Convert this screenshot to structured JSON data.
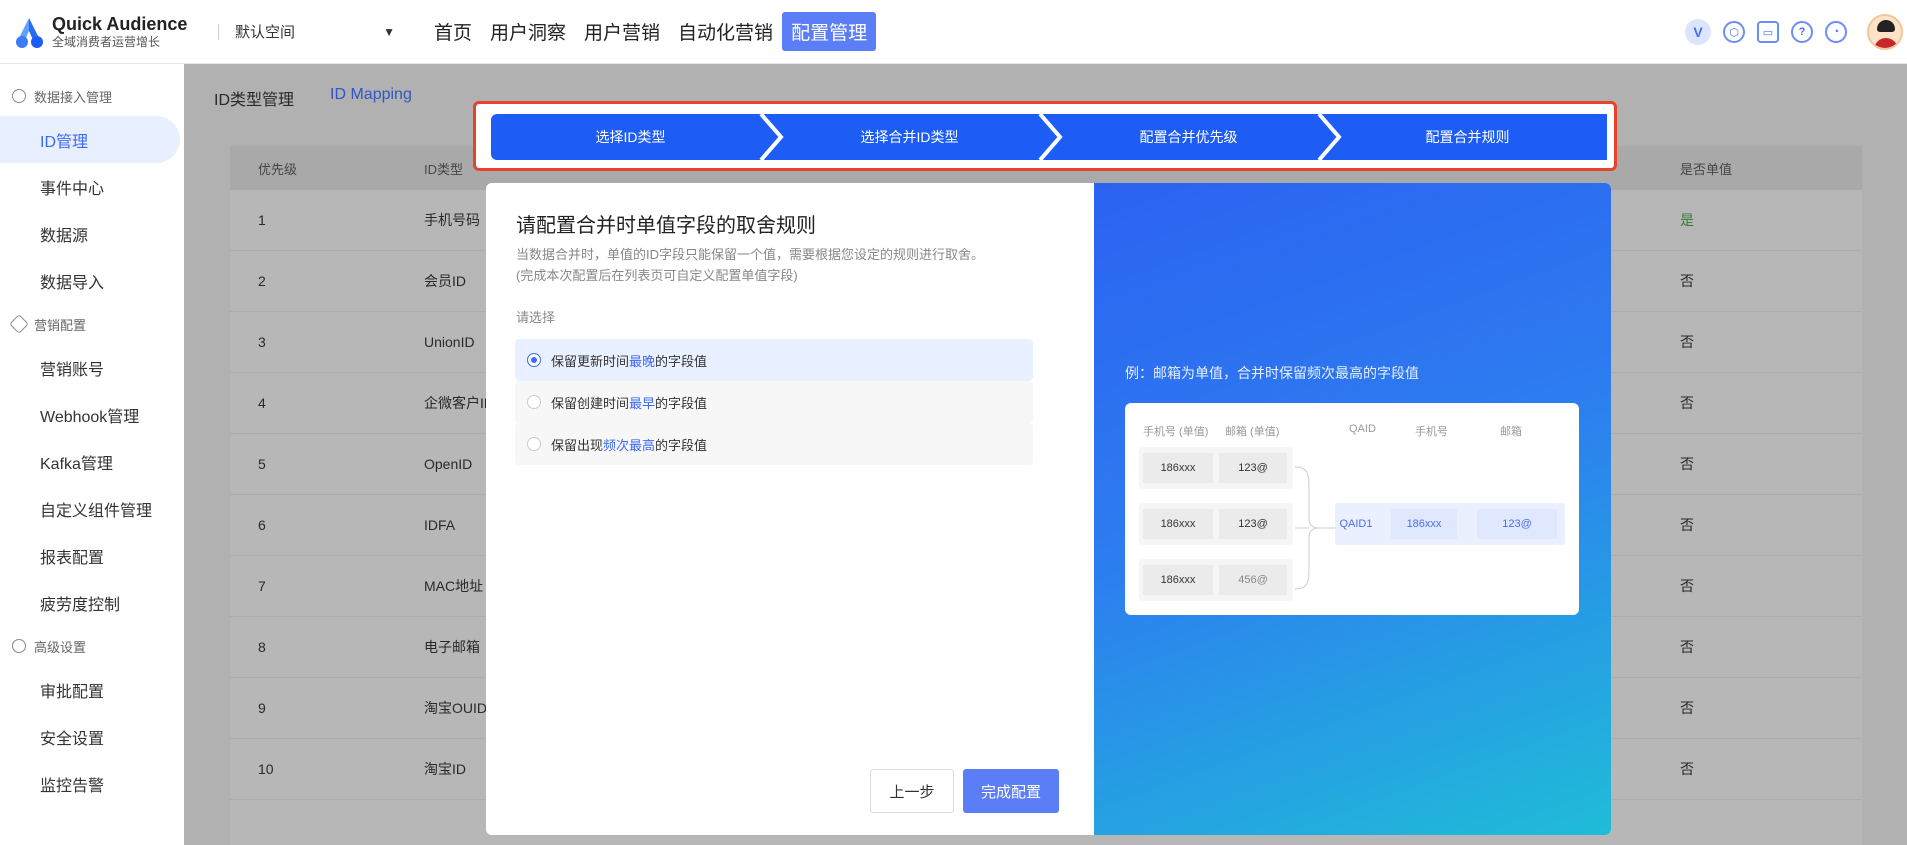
{
  "app": {
    "title": "Quick Audience",
    "subtitle": "全域消费者运营增长"
  },
  "workspace": {
    "name": "默认空间"
  },
  "nav": [
    {
      "label": "首页",
      "active": false
    },
    {
      "label": "用户洞察",
      "active": false
    },
    {
      "label": "用户营销",
      "active": false
    },
    {
      "label": "自动化营销",
      "active": false
    },
    {
      "label": "配置管理",
      "active": true
    }
  ],
  "top_icons": {
    "v_label": "V"
  },
  "sidebar": {
    "groups": [
      {
        "label": "数据接入管理",
        "items": [
          {
            "label": "ID管理",
            "active": true
          },
          {
            "label": "事件中心"
          },
          {
            "label": "数据源"
          },
          {
            "label": "数据导入"
          }
        ]
      },
      {
        "label": "营销配置",
        "items": [
          {
            "label": "营销账号"
          },
          {
            "label": "Webhook管理"
          },
          {
            "label": "Kafka管理"
          },
          {
            "label": "自定义组件管理"
          },
          {
            "label": "报表配置"
          },
          {
            "label": "疲劳度控制"
          }
        ]
      },
      {
        "label": "高级设置",
        "items": [
          {
            "label": "审批配置"
          },
          {
            "label": "安全设置"
          },
          {
            "label": "监控告警"
          }
        ]
      }
    ]
  },
  "subtabs": [
    {
      "label": "ID类型管理",
      "active": false
    },
    {
      "label": "ID Mapping",
      "active": true
    }
  ],
  "table": {
    "headers": {
      "priority": "优先级",
      "id_type": "ID类型",
      "single": "是否单值"
    },
    "rows": [
      {
        "priority": "1",
        "id_type": "手机号码",
        "single": "是"
      },
      {
        "priority": "2",
        "id_type": "会员ID",
        "single": "否"
      },
      {
        "priority": "3",
        "id_type": "UnionID",
        "single": "否"
      },
      {
        "priority": "4",
        "id_type": "企微客户ID",
        "single": "否"
      },
      {
        "priority": "5",
        "id_type": "OpenID",
        "single": "否"
      },
      {
        "priority": "6",
        "id_type": "IDFA",
        "single": "否"
      },
      {
        "priority": "7",
        "id_type": "MAC地址",
        "single": "否"
      },
      {
        "priority": "8",
        "id_type": "电子邮箱",
        "single": "否"
      },
      {
        "priority": "9",
        "id_type": "淘宝OUID",
        "single": "否"
      },
      {
        "priority": "10",
        "id_type": "淘宝ID",
        "single": "否"
      }
    ]
  },
  "steps": [
    "选择ID类型",
    "选择合并ID类型",
    "配置合并优先级",
    "配置合并规则"
  ],
  "dialog": {
    "title": "请配置合并时单值字段的取舍规则",
    "desc_line1": "当数据合并时，单值的ID字段只能保留一个值，需要根据您设定的规则进行取舍。",
    "desc_line2": "(完成本次配置后在列表页可自定义配置单值字段)",
    "choose_label": "请选择",
    "options": [
      {
        "pre": "保留更新时间",
        "hl": "最晚",
        "post": "的字段值",
        "selected": true
      },
      {
        "pre": "保留创建时间",
        "hl": "最早",
        "post": "的字段值",
        "selected": false
      },
      {
        "pre": "保留出现",
        "hl": "频次最高",
        "post": "的字段值",
        "selected": false
      }
    ],
    "prev_label": "上一步",
    "done_label": "完成配置",
    "example": {
      "title": "例：邮箱为单值，合并时保留频次最高的字段值",
      "headers": {
        "phone_single": "手机号 (单值)",
        "email_single": "邮箱 (单值)",
        "qaid": "QAID",
        "phone": "手机号",
        "email": "邮箱"
      },
      "rows": [
        {
          "phone": "186xxx",
          "email": "123@"
        },
        {
          "phone": "186xxx",
          "email": "123@"
        },
        {
          "phone": "186xxx",
          "email": "456@"
        }
      ],
      "result": {
        "qaid": "QAID1",
        "phone": "186xxx",
        "email": "123@"
      }
    }
  },
  "colors": {
    "accent": "#1d5cf5",
    "nav_active": "#5b7ef6",
    "highlight_frame": "#e8412c"
  }
}
